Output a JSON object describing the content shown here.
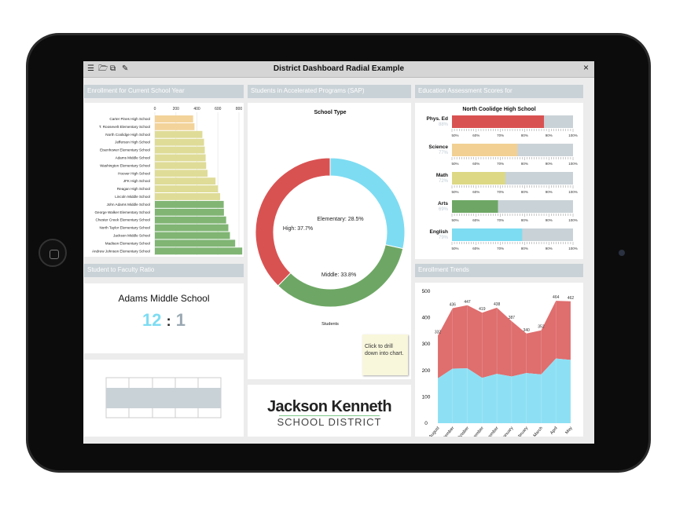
{
  "window": {
    "title": "District Dashboard Radial Example",
    "icons": [
      "menu-icon",
      "folder-open-icon",
      "layers-icon",
      "pencil-icon"
    ],
    "close": "×"
  },
  "enrollment": {
    "header": "Enrollment for Current School Year"
  },
  "sap": {
    "header": "Students in Accelerated Programs (SAP)",
    "note": "Click to drill down into chart."
  },
  "assessment": {
    "header": "Education Assessment Scores for"
  },
  "ratio": {
    "header": "Student to Faculty Ratio",
    "school": "Adams Middle School",
    "students": "12",
    "sep": ":",
    "faculty": "1"
  },
  "trends": {
    "header": "Enrollment Trends"
  },
  "logo": {
    "line1": "Jackson Kenneth",
    "line2": "SCHOOL DISTRICT"
  },
  "colors": {
    "red": "#d95252",
    "blue": "#7ddcf2",
    "green": "#6ea765",
    "orange": "#f2d093",
    "yellow": "#dcd884"
  },
  "chart_data": [
    {
      "type": "bar",
      "orientation": "horizontal",
      "xlim": [
        0,
        800
      ],
      "xticks": [
        "0",
        "200",
        "400",
        "600",
        "800"
      ],
      "categories": [
        "Carter Pines High School",
        "T. Roosevelt Elementary School",
        "North Coolidge High School",
        "Jefferson High School",
        "Eisenhower Elementary School",
        "Adams Middle School",
        "Washington Elementary School",
        "Hoover High School",
        "JFK High School",
        "Reagan High School",
        "Lincoln Middle School",
        "John Adams Middle School",
        "George Walker Elementary School",
        "Chester Creek Elementary School",
        "North Taylor Elementary School",
        "Jackson Middle School",
        "Madison Elementary School",
        "Andrew Johnson Elementary School"
      ],
      "values": [
        364,
        377,
        452,
        468,
        475,
        483,
        488,
        501,
        577,
        600,
        621,
        655,
        657,
        678,
        699,
        714,
        764,
        831
      ]
    },
    {
      "type": "pie",
      "subtype": "donut",
      "title": "School Type",
      "label": "Students",
      "slices": [
        {
          "name": "Elementary",
          "value": 28.5,
          "label": "Elementary: 28.5%",
          "color": "#7ddcf2"
        },
        {
          "name": "Middle",
          "value": 33.8,
          "label": "Middle: 33.8%",
          "color": "#6ea765"
        },
        {
          "name": "High",
          "value": 37.7,
          "label": "High: 37.7%",
          "color": "#d95252"
        }
      ]
    },
    {
      "type": "bullet",
      "title": "North Coolidge High School",
      "xlim": [
        50,
        100
      ],
      "ticks": [
        "50%",
        "60%",
        "70%",
        "80%",
        "90%",
        "100%"
      ],
      "items": [
        {
          "name": "Phys. Ed",
          "value": 88,
          "label": "88%",
          "color": "#d95252"
        },
        {
          "name": "Science",
          "value": 77,
          "label": "77%",
          "color": "#f2d093"
        },
        {
          "name": "Math",
          "value": 72,
          "label": "72%",
          "color": "#dcd884"
        },
        {
          "name": "Arts",
          "value": 69,
          "label": "69%",
          "color": "#6ea765"
        },
        {
          "name": "English",
          "value": 79,
          "label": "79%",
          "color": "#7ddcf2"
        }
      ]
    },
    {
      "type": "area",
      "stacked": true,
      "ylim": [
        0,
        500
      ],
      "yticks": [
        "0",
        "100",
        "200",
        "300",
        "400",
        "500"
      ],
      "categories": [
        "August",
        "September",
        "October",
        "November",
        "December",
        "January",
        "February",
        "March",
        "April",
        "May"
      ],
      "totals": [
        332,
        436,
        447,
        419,
        438,
        387,
        340,
        352,
        464,
        462
      ],
      "series": [
        {
          "values": [
            170,
            207,
            208,
            172,
            187,
            177,
            190,
            185,
            245,
            240
          ],
          "color": "#8de0f4"
        },
        {
          "values": [
            162,
            229,
            239,
            247,
            251,
            210,
            150,
            167,
            219,
            222
          ],
          "color": "#df6e6e"
        }
      ]
    }
  ]
}
